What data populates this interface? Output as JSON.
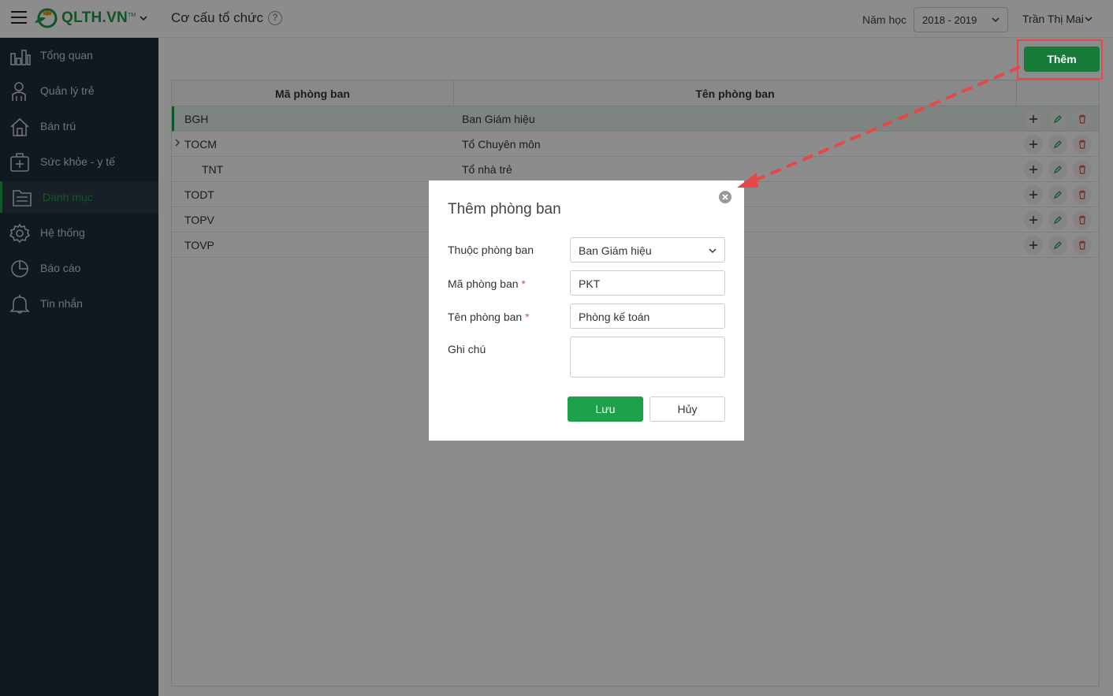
{
  "header": {
    "logo_text": "QLTH.VN",
    "logo_tm": "TM",
    "page_title": "Cơ cấu tổ chức",
    "year_label": "Năm học",
    "year_value": "2018 - 2019",
    "user_name": "Trần Thị Mai"
  },
  "sidebar": {
    "items": [
      {
        "label": "Tổng quan",
        "icon": "chart-icon"
      },
      {
        "label": "Quản lý trẻ",
        "icon": "child-icon"
      },
      {
        "label": "Bán trú",
        "icon": "home-icon"
      },
      {
        "label": "Sức khỏe - y tế",
        "icon": "medical-icon"
      },
      {
        "label": "Danh mục",
        "icon": "folder-icon"
      },
      {
        "label": "Hệ thống",
        "icon": "gear-icon"
      },
      {
        "label": "Báo cáo",
        "icon": "pie-icon"
      },
      {
        "label": "Tin nhắn",
        "icon": "bell-icon"
      }
    ],
    "active": "Danh mục"
  },
  "toolbar": {
    "add_label": "Thêm"
  },
  "table": {
    "headers": [
      "Mã phòng ban",
      "Tên phòng ban"
    ],
    "rows": [
      {
        "code": "BGH",
        "name": "Ban Giám hiệu"
      },
      {
        "code": "TOCM",
        "name": "Tổ Chuyên môn"
      },
      {
        "code": "TNT",
        "name": "Tổ nhà trẻ"
      },
      {
        "code": "TODT",
        "name": ""
      },
      {
        "code": "TOPV",
        "name": ""
      },
      {
        "code": "TOVP",
        "name": ""
      }
    ]
  },
  "modal": {
    "title": "Thêm phòng ban",
    "parent_label": "Thuộc phòng ban",
    "parent_value": "Ban Giám hiệu",
    "code_label": "Mã phòng ban",
    "code_value": "PKT",
    "name_label": "Tên phòng ban",
    "name_value": "Phòng kế toán",
    "note_label": "Ghi chú",
    "required_mark": "*",
    "save_label": "Lưu",
    "cancel_label": "Hủy"
  },
  "colors": {
    "brand_green": "#1ea14b",
    "sidebar_bg": "#1f2d3a",
    "annotation_red": "#e8474a"
  }
}
